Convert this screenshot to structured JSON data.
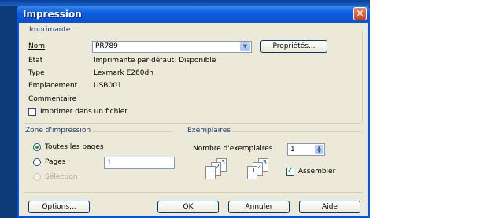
{
  "window": {
    "title": "Impression",
    "close_symbol": "✕"
  },
  "printer": {
    "group_title": "Imprimante",
    "name_label": "Nom",
    "name_value": "PR789",
    "properties_button": "Propriétés...",
    "status_label": "État",
    "status_value": "Imprimante par défaut; Disponible",
    "type_label": "Type",
    "type_value": "Lexmark E260dn",
    "location_label": "Emplacement",
    "location_value": "USB001",
    "comment_label": "Commentaire",
    "print_to_file_label": "Imprimer dans un fichier",
    "print_to_file_checked": false
  },
  "print_range": {
    "group_title": "Zone d'impression",
    "all_pages_label": "Toutes les pages",
    "pages_label": "Pages",
    "pages_value": "1",
    "selection_label": "Sélection",
    "selected": "all"
  },
  "copies": {
    "group_title": "Exemplaires",
    "count_label": "Nombre d'exemplaires",
    "count_value": "1",
    "collate_label": "Assembler",
    "collate_checked": true,
    "page_numbers": [
      "1",
      "2",
      "3"
    ]
  },
  "footer": {
    "options_button": "Options...",
    "ok_button": "OK",
    "cancel_button": "Annuler",
    "help_button": "Aide"
  },
  "icons": {
    "spin_up": "▲",
    "spin_down": "▼",
    "dropdown": "▼"
  }
}
